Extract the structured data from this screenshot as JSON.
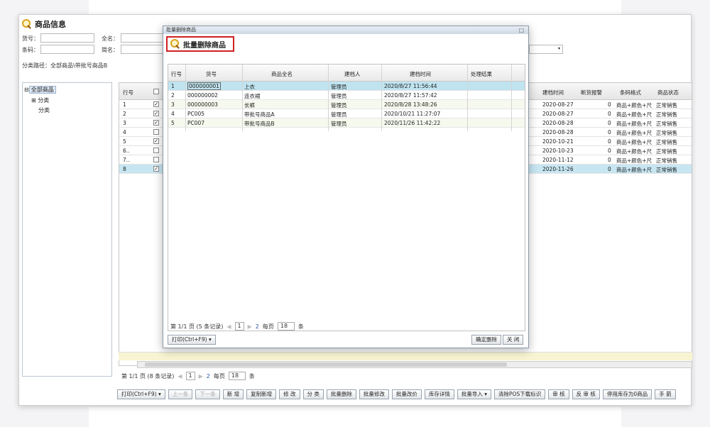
{
  "app": {
    "title": "商品信息"
  },
  "filters": {
    "huohao_label": "货号：",
    "quanming_label": "全名：",
    "tiaoma_label": "条码：",
    "jianming_label": "简名："
  },
  "path": "分类路径：全部商品\\带批号商品B",
  "tree": {
    "root": "全部商品",
    "child1": "分类",
    "child2": "分类"
  },
  "main_grid": {
    "headers": {
      "row": "行号",
      "check": "",
      "date": "建档时间",
      "shortage": "断货报警",
      "barcode": "条码格式",
      "status": "商品状态"
    },
    "rows": [
      {
        "n": "1",
        "checked": true,
        "date": "2020-08-27",
        "alarm": "0",
        "fmt": "商品+颜色+尺",
        "status": "正常销售"
      },
      {
        "n": "2",
        "checked": true,
        "date": "2020-08-27",
        "alarm": "0",
        "fmt": "商品+颜色+尺",
        "status": "正常销售"
      },
      {
        "n": "3",
        "checked": true,
        "date": "2020-08-28",
        "alarm": "0",
        "fmt": "商品+颜色+尺",
        "status": "正常销售"
      },
      {
        "n": "4",
        "checked": false,
        "date": "2020-08-28",
        "alarm": "0",
        "fmt": "商品+颜色+尺",
        "status": "正常销售"
      },
      {
        "n": "5",
        "checked": true,
        "date": "2020-10-21",
        "alarm": "0",
        "fmt": "商品+颜色+尺",
        "status": "正常销售"
      },
      {
        "n": "6..",
        "checked": false,
        "date": "2020-10-23",
        "alarm": "0",
        "fmt": "商品+颜色+尺",
        "status": "正常销售"
      },
      {
        "n": "7..",
        "checked": false,
        "date": "2020-11-12",
        "alarm": "0",
        "fmt": "商品+颜色+尺",
        "status": "正常销售"
      },
      {
        "n": "8",
        "checked": true,
        "date": "2020-11-26",
        "alarm": "0",
        "fmt": "商品+颜色+尺",
        "status": "正常销售"
      }
    ]
  },
  "main_pager": {
    "info": "第 1/1 页 (8 条记录)",
    "page": "1",
    "total_pages": "2",
    "per_page_label": "每页",
    "per_page": "18",
    "unit": "条"
  },
  "buttons": [
    "打印(Ctrl+F9) ▾",
    "上一条",
    "下一条",
    "新 增",
    "复制新增",
    "修 改",
    "分 类",
    "批量删除",
    "批量修改",
    "批量改价",
    "库存详情",
    "批量导入 ▾",
    "清除POS下载标识",
    "审 核",
    "反 审 核",
    "停用库存为0商品",
    "手 箭"
  ],
  "modal": {
    "window_title": "批量删除商品",
    "heading": "批量删除商品",
    "headers": [
      "行号",
      "货号",
      "商品全名",
      "建档人",
      "建档时间",
      "处理结果"
    ],
    "rows": [
      {
        "n": "1",
        "code": "000000001",
        "name": "上衣",
        "creator": "管理员",
        "time": "2020/8/27 11:56:44",
        "result": ""
      },
      {
        "n": "2",
        "code": "000000002",
        "name": "连衣裙",
        "creator": "管理员",
        "time": "2020/8/27 11:57:42",
        "result": ""
      },
      {
        "n": "3",
        "code": "000000003",
        "name": "长裤",
        "creator": "管理员",
        "time": "2020/8/28 13:48:26",
        "result": ""
      },
      {
        "n": "4",
        "code": "PC005",
        "name": "带批号商品A",
        "creator": "管理员",
        "time": "2020/10/21 11:27:07",
        "result": ""
      },
      {
        "n": "5",
        "code": "PC007",
        "name": "带批号商品B",
        "creator": "管理员",
        "time": "2020/11/26 11:42:22",
        "result": ""
      }
    ],
    "pager": {
      "info": "第 1/1 页 (5 条记录)",
      "page": "1",
      "total_pages": "2",
      "per_page_label": "每页",
      "per_page": "18",
      "unit": "条"
    },
    "print_button": "打印(Ctrl+F9) ▾",
    "confirm_button": "确定删除",
    "close_button": "关 闭"
  }
}
